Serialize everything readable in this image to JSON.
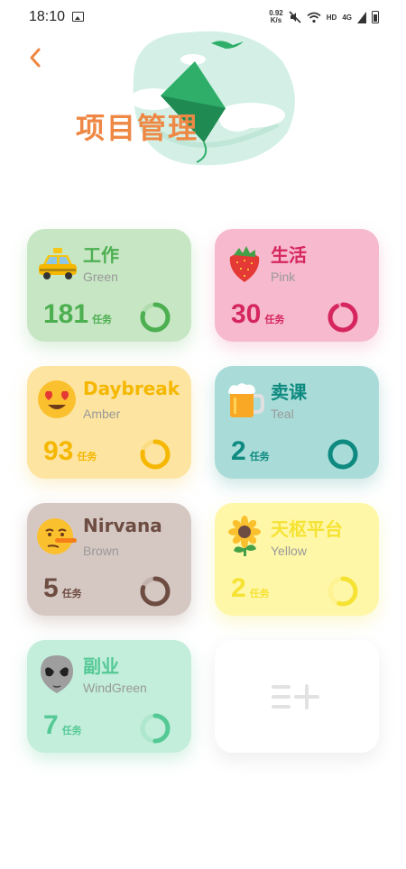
{
  "status_bar": {
    "time": "18:10",
    "net_speed_value": "0.92",
    "net_speed_unit": "K/s",
    "hd_label": "HD",
    "network_label": "4G",
    "icons": [
      "image-icon",
      "mute-icon",
      "wifi-icon",
      "signal-icon",
      "battery-icon"
    ]
  },
  "header": {
    "title": "项目管理",
    "back_icon": "chevron-left-icon",
    "accent_color": "#ee8844"
  },
  "projects": [
    {
      "name": "工作",
      "color_name": "Green",
      "count": "181",
      "unit": "任务",
      "emoji": "🚕",
      "color": "#4caf50",
      "progress": 0.8
    },
    {
      "name": "生活",
      "color_name": "Pink",
      "count": "30",
      "unit": "任务",
      "emoji": "🍓",
      "color": "#d6265f",
      "progress": 0.92
    },
    {
      "name": "Daybreak",
      "color_name": "Amber",
      "count": "93",
      "unit": "任务",
      "emoji": "😍",
      "color": "#f5b700",
      "progress": 0.78
    },
    {
      "name": "卖课",
      "color_name": "Teal",
      "count": "2",
      "unit": "任务",
      "emoji": "🍺",
      "color": "#0e8a80",
      "progress": 1.0
    },
    {
      "name": "Nirvana",
      "color_name": "Brown",
      "count": "5",
      "unit": "任务",
      "emoji": "🤥",
      "color": "#6d4c41",
      "progress": 0.8
    },
    {
      "name": "天枢平台",
      "color_name": "Yellow",
      "count": "2",
      "unit": "任务",
      "emoji": "🌻",
      "color": "#f5e233",
      "progress": 0.55
    },
    {
      "name": "副业",
      "color_name": "WindGreen",
      "count": "7",
      "unit": "任务",
      "emoji": "👽",
      "color": "#55c995",
      "progress": 0.5
    }
  ],
  "add_card": {
    "icon": "add-list-icon"
  }
}
